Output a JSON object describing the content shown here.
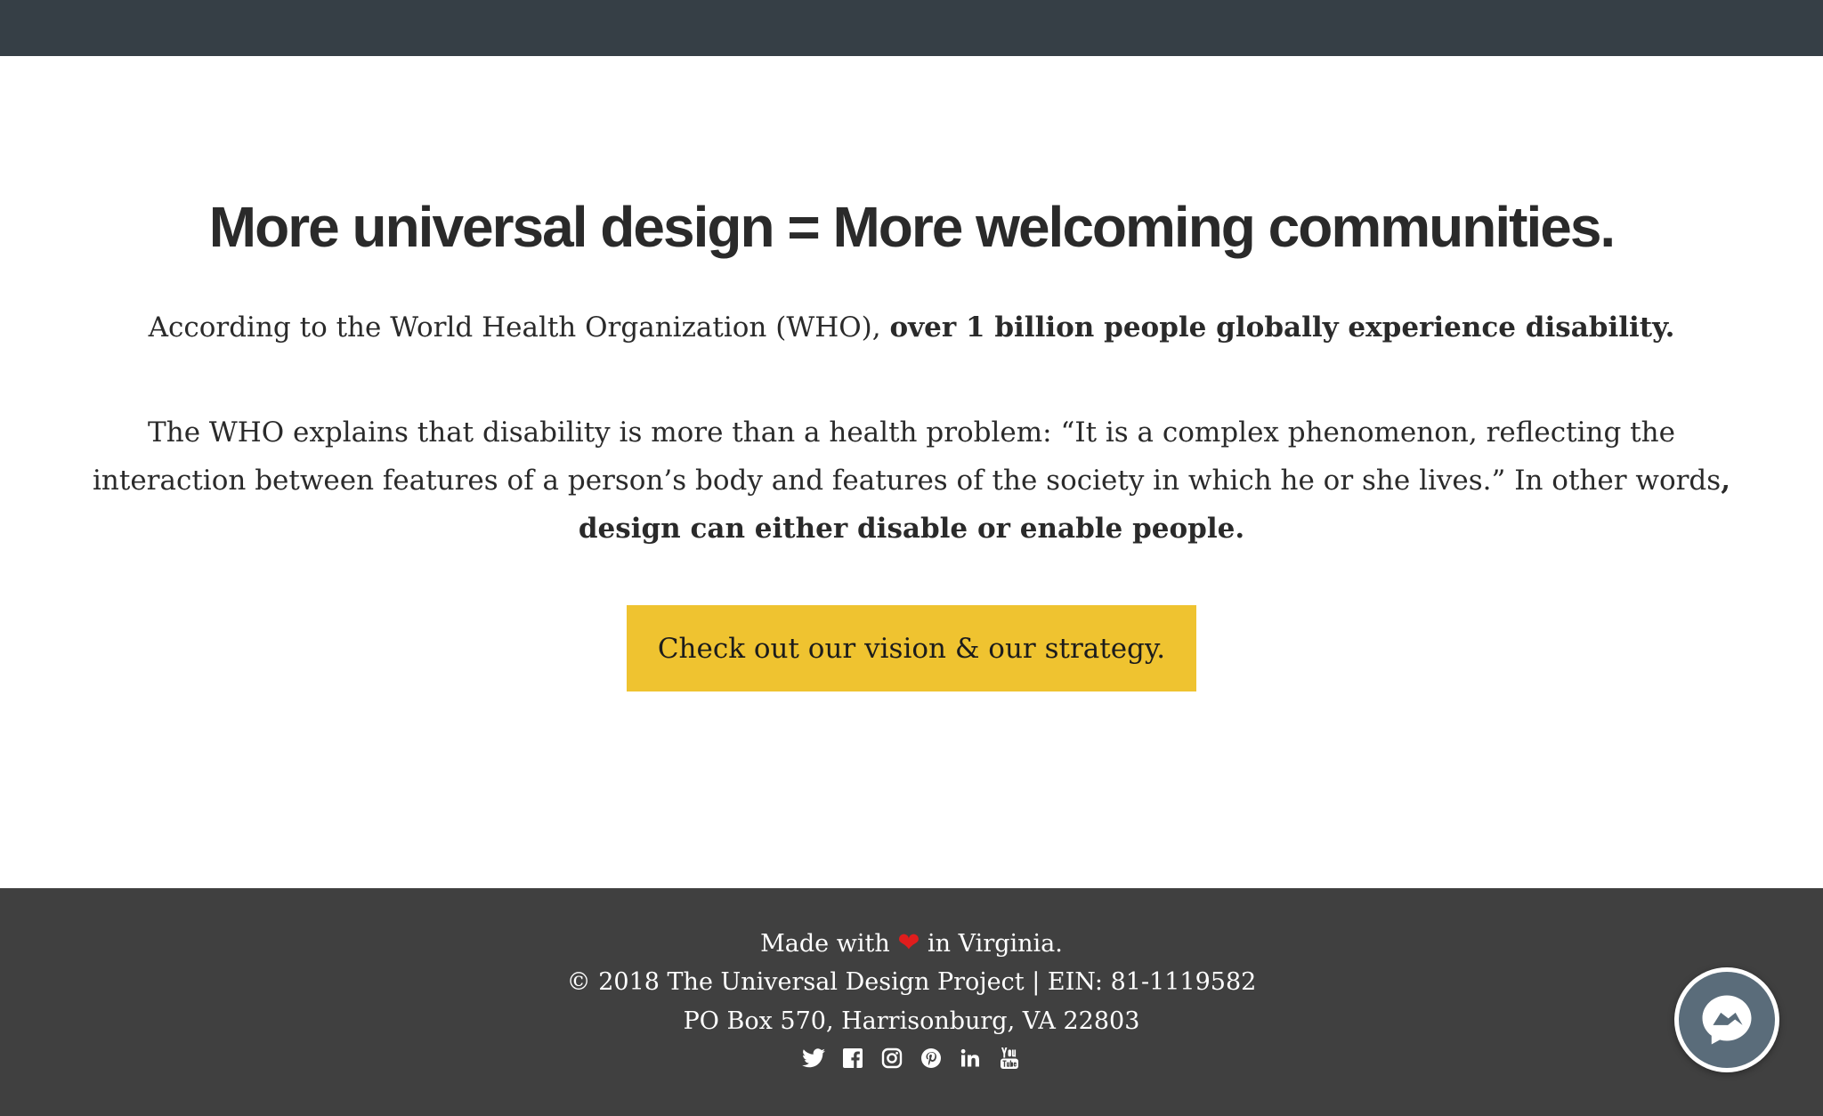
{
  "hero": {
    "heading": "More universal design = More welcoming communities.",
    "p1_text": "According to the World Health Organization (WHO), ",
    "p1_bold": "over 1 billion people globally experience disability.",
    "p2_text": "The WHO explains that disability is more than a health problem: “It is a complex phenomenon, reflecting the interaction between features of a person’s body and features of the society in which he or she lives.” In other words",
    "p2_bold": ", design can either disable or enable people.",
    "cta_label": "Check out our vision & our strategy."
  },
  "footer": {
    "made_with": "Made with",
    "in_virginia": "in Virginia.",
    "copyright": "© 2018 The Universal Design Project | EIN: 81-1119582",
    "address": "PO Box 570, Harrisonburg, VA 22803",
    "social": [
      "twitter-icon",
      "facebook-icon",
      "instagram-icon",
      "pinterest-icon",
      "linkedin-icon",
      "youtube-icon"
    ]
  },
  "colors": {
    "topbar": "#363f46",
    "cta_background": "#efc330",
    "footer_background": "#404040",
    "heart": "#e01d1d",
    "messenger": "#5a6c7a"
  },
  "chat": {
    "icon": "messenger-icon"
  }
}
